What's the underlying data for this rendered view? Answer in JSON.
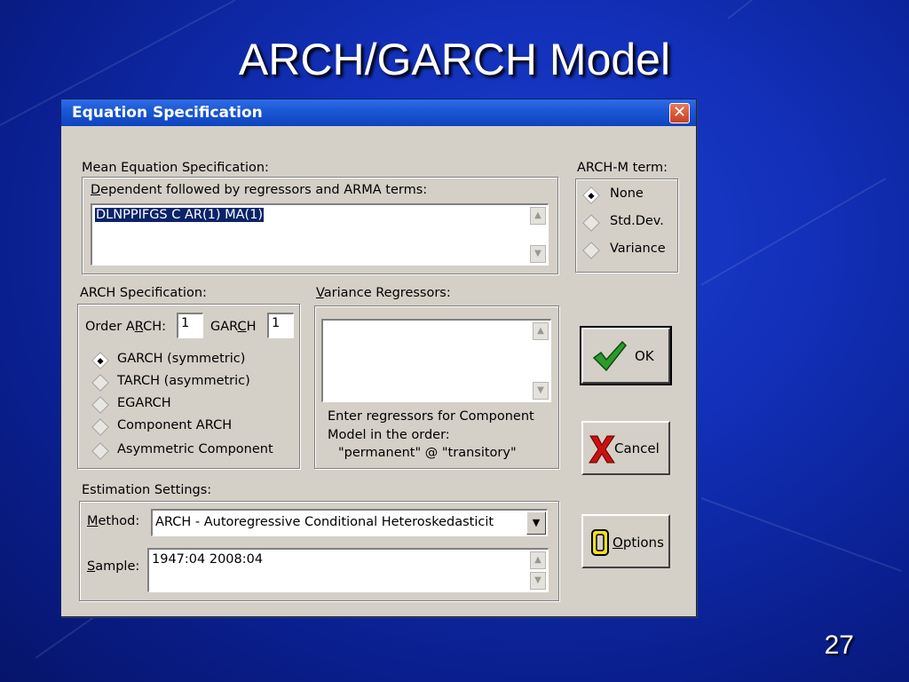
{
  "slide": {
    "title": "ARCH/GARCH Model",
    "page_number": "27"
  },
  "dialog": {
    "title": "Equation Specification",
    "close_glyph": "✕",
    "mean_eq": {
      "group_label": "Mean Equation Specification:",
      "field_label": "Dependent followed by regressors and ARMA terms:",
      "value": "DLNPPIFGS C AR(1) MA(1)"
    },
    "archm": {
      "label": "ARCH-M term:",
      "options": [
        "None",
        "Std.Dev.",
        "Variance"
      ],
      "selected": "None"
    },
    "arch_spec": {
      "label": "ARCH Specification:",
      "order_arch_label": "Order ARCH:",
      "order_arch_value": "1",
      "garch_label": "GARCH",
      "garch_value": "1",
      "models": [
        "GARCH (symmetric)",
        "TARCH (asymmetric)",
        "EGARCH",
        "Component ARCH",
        "Asymmetric Component"
      ],
      "selected": "GARCH (symmetric)"
    },
    "variance_regressors": {
      "label": "Variance Regressors:",
      "value": "",
      "help_line1": "Enter regressors for Component",
      "help_line2": "Model in the order:",
      "help_line3": "\"permanent\" @ \"transitory\""
    },
    "buttons": {
      "ok": "OK",
      "cancel": "Cancel",
      "options": "Options"
    },
    "estimation": {
      "label": "Estimation Settings:",
      "method_label": "Method:",
      "method_value": "ARCH  -  Autoregressive Conditional Heteroskedasticit",
      "sample_label": "Sample:",
      "sample_value": "1947:04 2008:04"
    },
    "icons": [
      "check-icon",
      "x-icon",
      "options-bracket-icon",
      "scroll-up-icon",
      "scroll-down-icon",
      "dropdown-arrow-icon"
    ],
    "colors": {
      "titlebar": "#1c58d6",
      "dialog_face": "#d4d0c8",
      "selection": "#0a246a",
      "slide_bg": "#1230b8"
    }
  }
}
